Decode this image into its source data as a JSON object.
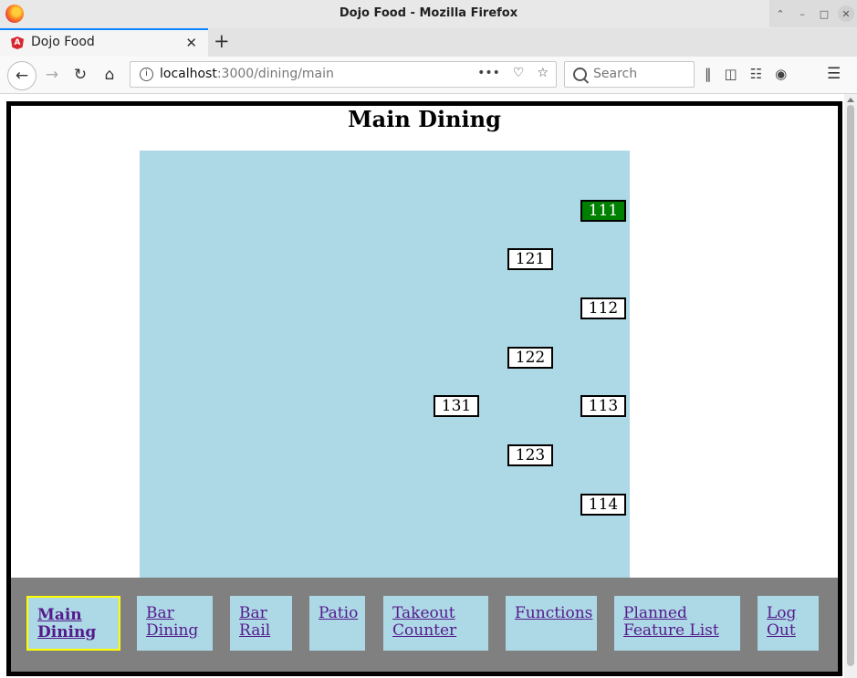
{
  "window": {
    "title": "Dojo Food - Mozilla Firefox"
  },
  "tab": {
    "title": "Dojo Food"
  },
  "address": {
    "host": "localhost",
    "path": ":3000/dining/main"
  },
  "search": {
    "placeholder": "Search"
  },
  "page": {
    "title": "Main Dining"
  },
  "tables": [
    {
      "number": "111",
      "status": "occupied"
    },
    {
      "number": "121",
      "status": "open"
    },
    {
      "number": "112",
      "status": "open"
    },
    {
      "number": "122",
      "status": "open"
    },
    {
      "number": "131",
      "status": "open"
    },
    {
      "number": "113",
      "status": "open"
    },
    {
      "number": "123",
      "status": "open"
    },
    {
      "number": "114",
      "status": "open"
    }
  ],
  "nav": [
    {
      "label": "Main Dining",
      "active": true
    },
    {
      "label": "Bar Dining"
    },
    {
      "label": "Bar Rail"
    },
    {
      "label": "Patio"
    },
    {
      "label": "Takeout Counter"
    },
    {
      "label": "Functions"
    },
    {
      "label": "Planned Feature List"
    },
    {
      "label": "Log Out"
    }
  ],
  "colors": {
    "floor": "#add8e6",
    "occupied": "#008000",
    "panel": "#808080",
    "active_border": "#ffff00"
  }
}
